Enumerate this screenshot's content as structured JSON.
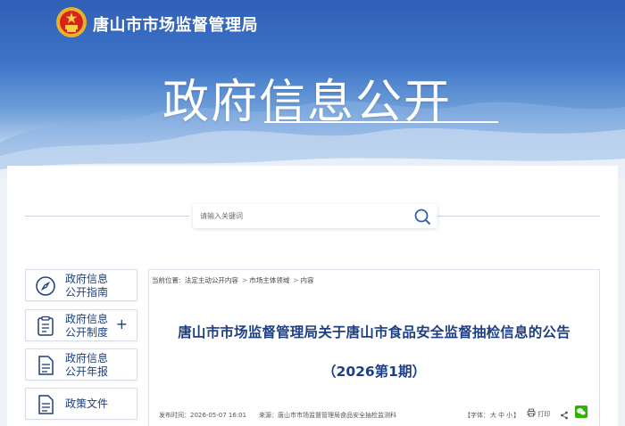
{
  "site": {
    "title": "唐山市市场监督管理局"
  },
  "banner": {
    "heading": "政府信息公开"
  },
  "search": {
    "placeholder": "请输入关键词"
  },
  "sidebar": {
    "items": [
      {
        "label": "政府信息\n公开指南",
        "icon": "compass-icon"
      },
      {
        "label": "政府信息\n公开制度",
        "icon": "document-list-icon",
        "expand": "+"
      },
      {
        "label": "政府信息\n公开年报",
        "icon": "document-icon"
      },
      {
        "label": "政策文件",
        "icon": "document-icon"
      }
    ]
  },
  "breadcrumb": {
    "prefix": "当前位置:",
    "items": [
      "法定主动公开内容",
      "市场主体领域",
      "内容"
    ],
    "separator": ">"
  },
  "article": {
    "title": "唐山市市场监督管理局关于唐山市食品安全监督抽检信息的公告",
    "issue": "（2026第1期）",
    "published": "发布时间：2026-05-07 16:01",
    "source": "来源：唐山市市场监督管理局食品安全抽检监测科",
    "font_label": "【字体：",
    "font_sizes": [
      "大",
      "中",
      "小"
    ],
    "font_close": "】",
    "print_label": "打印"
  },
  "colors": {
    "banner_top": "#2f5fb6",
    "title_blue": "#1d3f86",
    "nav_blue": "#1e3f7d",
    "wechat_green": "#2db400"
  }
}
